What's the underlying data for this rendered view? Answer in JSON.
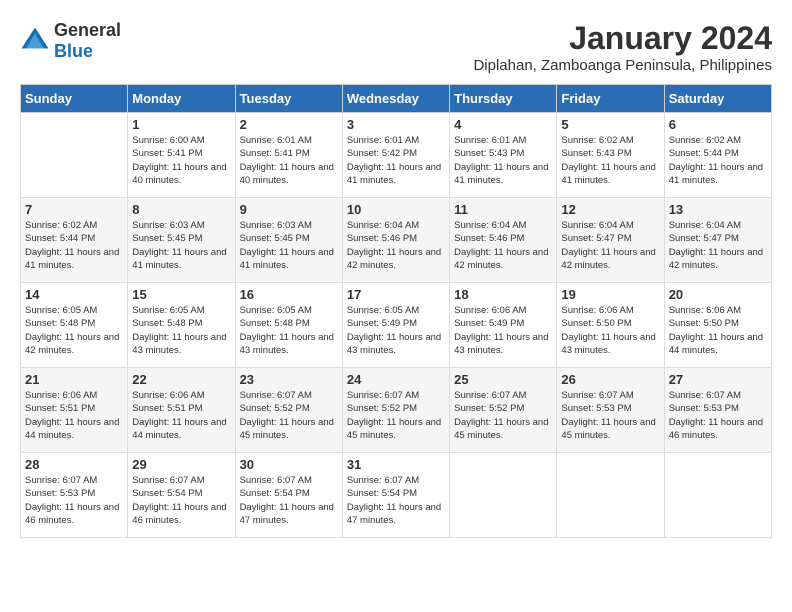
{
  "header": {
    "logo": {
      "text_general": "General",
      "text_blue": "Blue"
    },
    "title": "January 2024",
    "location": "Diplahan, Zamboanga Peninsula, Philippines"
  },
  "calendar": {
    "days_of_week": [
      "Sunday",
      "Monday",
      "Tuesday",
      "Wednesday",
      "Thursday",
      "Friday",
      "Saturday"
    ],
    "weeks": [
      [
        {
          "day": "",
          "sunrise": "",
          "sunset": "",
          "daylight": ""
        },
        {
          "day": "1",
          "sunrise": "Sunrise: 6:00 AM",
          "sunset": "Sunset: 5:41 PM",
          "daylight": "Daylight: 11 hours and 40 minutes."
        },
        {
          "day": "2",
          "sunrise": "Sunrise: 6:01 AM",
          "sunset": "Sunset: 5:41 PM",
          "daylight": "Daylight: 11 hours and 40 minutes."
        },
        {
          "day": "3",
          "sunrise": "Sunrise: 6:01 AM",
          "sunset": "Sunset: 5:42 PM",
          "daylight": "Daylight: 11 hours and 41 minutes."
        },
        {
          "day": "4",
          "sunrise": "Sunrise: 6:01 AM",
          "sunset": "Sunset: 5:43 PM",
          "daylight": "Daylight: 11 hours and 41 minutes."
        },
        {
          "day": "5",
          "sunrise": "Sunrise: 6:02 AM",
          "sunset": "Sunset: 5:43 PM",
          "daylight": "Daylight: 11 hours and 41 minutes."
        },
        {
          "day": "6",
          "sunrise": "Sunrise: 6:02 AM",
          "sunset": "Sunset: 5:44 PM",
          "daylight": "Daylight: 11 hours and 41 minutes."
        }
      ],
      [
        {
          "day": "7",
          "sunrise": "Sunrise: 6:02 AM",
          "sunset": "Sunset: 5:44 PM",
          "daylight": "Daylight: 11 hours and 41 minutes."
        },
        {
          "day": "8",
          "sunrise": "Sunrise: 6:03 AM",
          "sunset": "Sunset: 5:45 PM",
          "daylight": "Daylight: 11 hours and 41 minutes."
        },
        {
          "day": "9",
          "sunrise": "Sunrise: 6:03 AM",
          "sunset": "Sunset: 5:45 PM",
          "daylight": "Daylight: 11 hours and 41 minutes."
        },
        {
          "day": "10",
          "sunrise": "Sunrise: 6:04 AM",
          "sunset": "Sunset: 5:46 PM",
          "daylight": "Daylight: 11 hours and 42 minutes."
        },
        {
          "day": "11",
          "sunrise": "Sunrise: 6:04 AM",
          "sunset": "Sunset: 5:46 PM",
          "daylight": "Daylight: 11 hours and 42 minutes."
        },
        {
          "day": "12",
          "sunrise": "Sunrise: 6:04 AM",
          "sunset": "Sunset: 5:47 PM",
          "daylight": "Daylight: 11 hours and 42 minutes."
        },
        {
          "day": "13",
          "sunrise": "Sunrise: 6:04 AM",
          "sunset": "Sunset: 5:47 PM",
          "daylight": "Daylight: 11 hours and 42 minutes."
        }
      ],
      [
        {
          "day": "14",
          "sunrise": "Sunrise: 6:05 AM",
          "sunset": "Sunset: 5:48 PM",
          "daylight": "Daylight: 11 hours and 42 minutes."
        },
        {
          "day": "15",
          "sunrise": "Sunrise: 6:05 AM",
          "sunset": "Sunset: 5:48 PM",
          "daylight": "Daylight: 11 hours and 43 minutes."
        },
        {
          "day": "16",
          "sunrise": "Sunrise: 6:05 AM",
          "sunset": "Sunset: 5:48 PM",
          "daylight": "Daylight: 11 hours and 43 minutes."
        },
        {
          "day": "17",
          "sunrise": "Sunrise: 6:05 AM",
          "sunset": "Sunset: 5:49 PM",
          "daylight": "Daylight: 11 hours and 43 minutes."
        },
        {
          "day": "18",
          "sunrise": "Sunrise: 6:06 AM",
          "sunset": "Sunset: 5:49 PM",
          "daylight": "Daylight: 11 hours and 43 minutes."
        },
        {
          "day": "19",
          "sunrise": "Sunrise: 6:06 AM",
          "sunset": "Sunset: 5:50 PM",
          "daylight": "Daylight: 11 hours and 43 minutes."
        },
        {
          "day": "20",
          "sunrise": "Sunrise: 6:06 AM",
          "sunset": "Sunset: 5:50 PM",
          "daylight": "Daylight: 11 hours and 44 minutes."
        }
      ],
      [
        {
          "day": "21",
          "sunrise": "Sunrise: 6:06 AM",
          "sunset": "Sunset: 5:51 PM",
          "daylight": "Daylight: 11 hours and 44 minutes."
        },
        {
          "day": "22",
          "sunrise": "Sunrise: 6:06 AM",
          "sunset": "Sunset: 5:51 PM",
          "daylight": "Daylight: 11 hours and 44 minutes."
        },
        {
          "day": "23",
          "sunrise": "Sunrise: 6:07 AM",
          "sunset": "Sunset: 5:52 PM",
          "daylight": "Daylight: 11 hours and 45 minutes."
        },
        {
          "day": "24",
          "sunrise": "Sunrise: 6:07 AM",
          "sunset": "Sunset: 5:52 PM",
          "daylight": "Daylight: 11 hours and 45 minutes."
        },
        {
          "day": "25",
          "sunrise": "Sunrise: 6:07 AM",
          "sunset": "Sunset: 5:52 PM",
          "daylight": "Daylight: 11 hours and 45 minutes."
        },
        {
          "day": "26",
          "sunrise": "Sunrise: 6:07 AM",
          "sunset": "Sunset: 5:53 PM",
          "daylight": "Daylight: 11 hours and 45 minutes."
        },
        {
          "day": "27",
          "sunrise": "Sunrise: 6:07 AM",
          "sunset": "Sunset: 5:53 PM",
          "daylight": "Daylight: 11 hours and 46 minutes."
        }
      ],
      [
        {
          "day": "28",
          "sunrise": "Sunrise: 6:07 AM",
          "sunset": "Sunset: 5:53 PM",
          "daylight": "Daylight: 11 hours and 46 minutes."
        },
        {
          "day": "29",
          "sunrise": "Sunrise: 6:07 AM",
          "sunset": "Sunset: 5:54 PM",
          "daylight": "Daylight: 11 hours and 46 minutes."
        },
        {
          "day": "30",
          "sunrise": "Sunrise: 6:07 AM",
          "sunset": "Sunset: 5:54 PM",
          "daylight": "Daylight: 11 hours and 47 minutes."
        },
        {
          "day": "31",
          "sunrise": "Sunrise: 6:07 AM",
          "sunset": "Sunset: 5:54 PM",
          "daylight": "Daylight: 11 hours and 47 minutes."
        },
        {
          "day": "",
          "sunrise": "",
          "sunset": "",
          "daylight": ""
        },
        {
          "day": "",
          "sunrise": "",
          "sunset": "",
          "daylight": ""
        },
        {
          "day": "",
          "sunrise": "",
          "sunset": "",
          "daylight": ""
        }
      ]
    ]
  }
}
